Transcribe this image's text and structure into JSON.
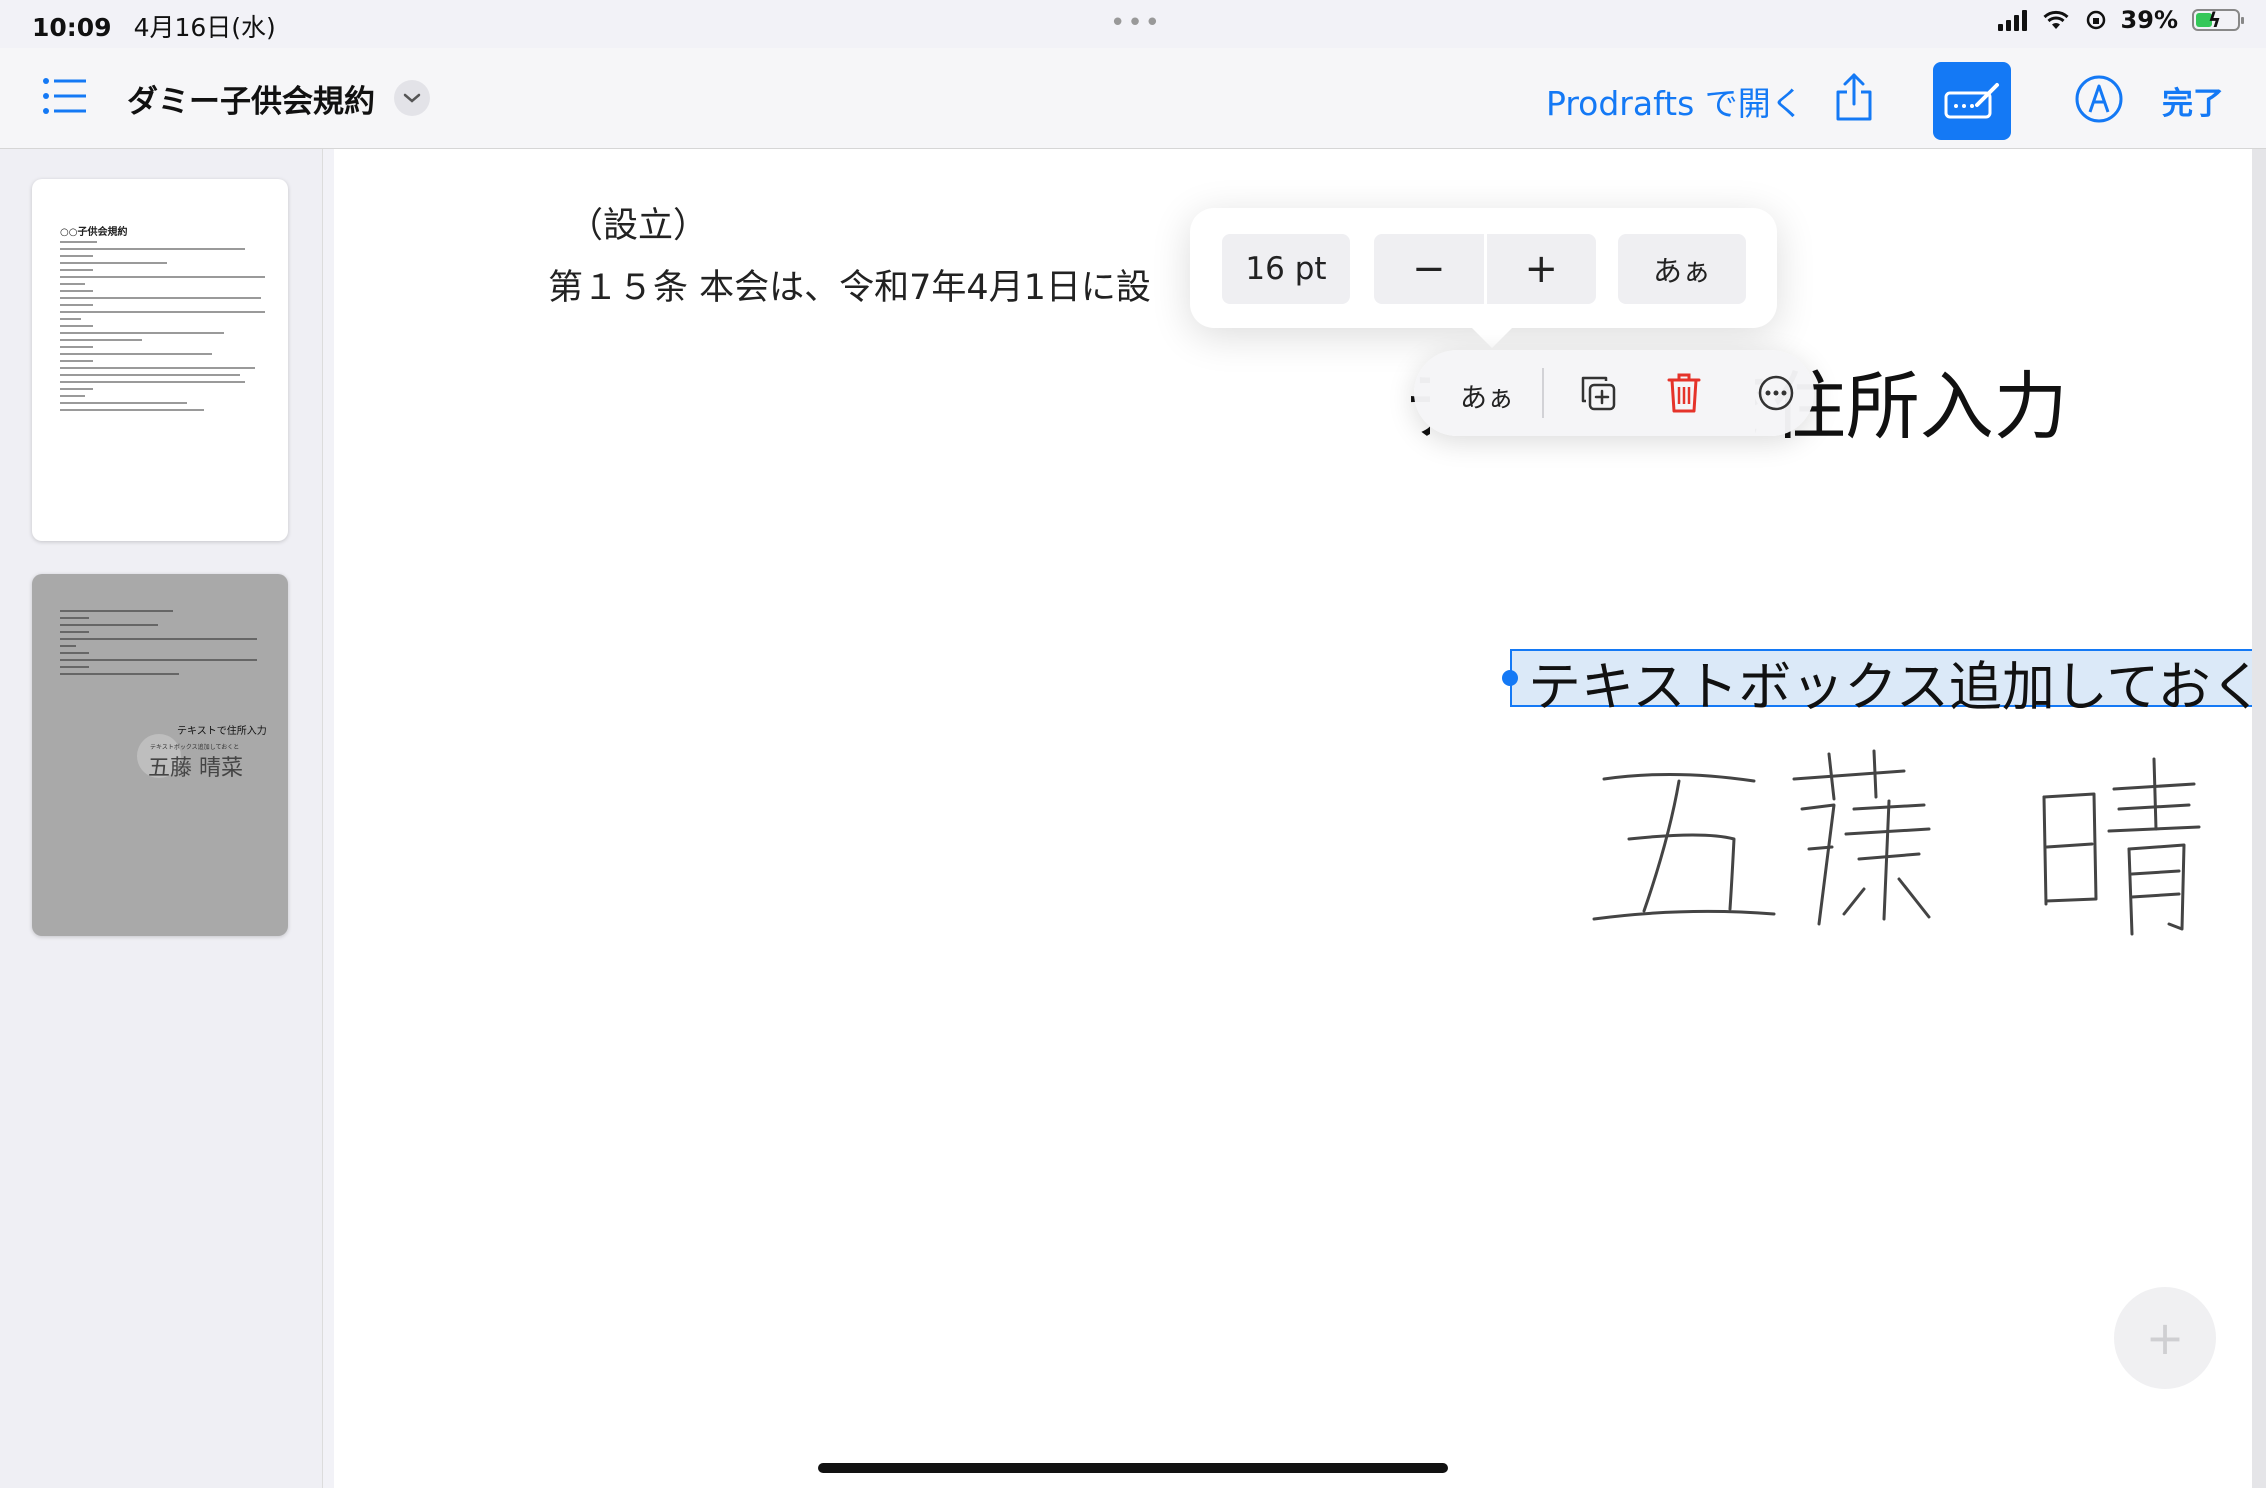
{
  "status": {
    "time": "10:09",
    "date": "4月16日(水)",
    "battery_percent": "39%",
    "battery_level": 0.39,
    "multitask": "•••"
  },
  "toolbar": {
    "title": "ダミー子供会規約",
    "open_in": "Prodrafts で開く",
    "done": "完了",
    "accent": "#1479f5"
  },
  "document": {
    "section_heading": "（設立）",
    "article_text": "第１５条 本会は、令和7年4月1日に設",
    "heading_text": "テキストで住所入力",
    "textbox_text": "テキストボックス追加しておくと",
    "signature": "五藤 晴菜"
  },
  "format_popover": {
    "font_size": "16 pt",
    "decrease": "−",
    "increase": "+",
    "font_label": "あぁ"
  },
  "edit_menu": {
    "font_label": "あぁ"
  },
  "thumbnails": {
    "page1_title": "○○子供会規約",
    "page2_caption": "テキストで住所入力",
    "page2_sub": "テキストボックス追加しておくと",
    "page2_signature": "五藤 晴菜"
  },
  "add_button": "+"
}
